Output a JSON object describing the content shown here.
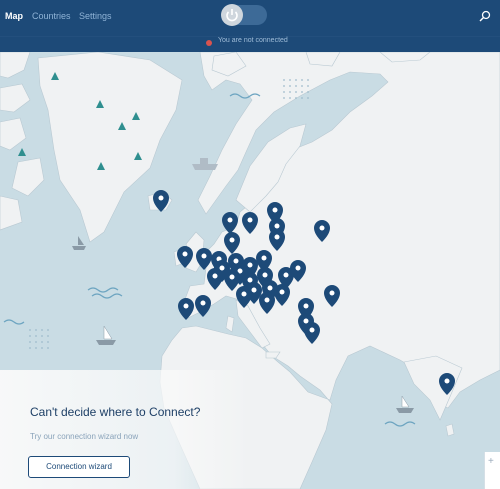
{
  "nav": {
    "tabs": [
      {
        "label": "Map",
        "active": true
      },
      {
        "label": "Countries",
        "active": false
      },
      {
        "label": "Settings",
        "active": false
      }
    ],
    "search_icon": "search-icon",
    "power_toggle": {
      "icon": "power-icon",
      "on": false
    }
  },
  "status": {
    "text": "You are not connected",
    "dot_color": "#d9534f"
  },
  "map": {
    "pin_color": "#1d4a78",
    "land_color": "#f0f2f3",
    "water_color": "#c9dce4",
    "server_pin_count": 40
  },
  "wizard": {
    "title": "Can't decide where to Connect?",
    "subtitle": "Try our connection wizard now",
    "button_label": "Connection wizard"
  },
  "zoom": {
    "plus_label": "+"
  }
}
